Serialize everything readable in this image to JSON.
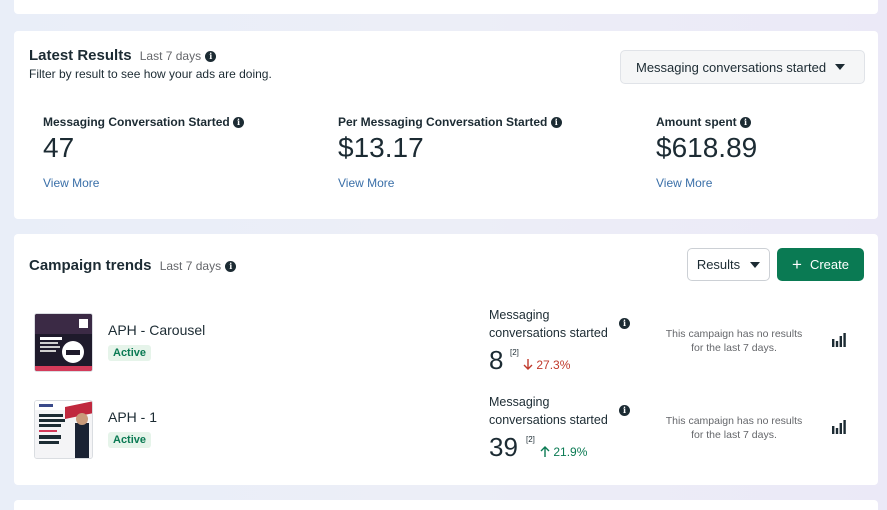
{
  "latest_results": {
    "title": "Latest Results",
    "period": "Last 7 days",
    "helper": "Filter by result to see how your ads are doing.",
    "filter_selected": "Messaging conversations started",
    "metrics": [
      {
        "label": "Messaging Conversation Started",
        "value": "47",
        "link": "View More"
      },
      {
        "label": "Per Messaging Conversation Started",
        "value": "$13.17",
        "link": "View More"
      },
      {
        "label": "Amount spent",
        "value": "$618.89",
        "link": "View More"
      }
    ]
  },
  "campaign_trends": {
    "title": "Campaign trends",
    "period": "Last 7 days",
    "results_button": "Results",
    "create_button": "Create",
    "campaigns": [
      {
        "name": "APH - Carousel",
        "status": "Active",
        "result_label": "Messaging conversations started",
        "result_value": "8",
        "result_sup": "[2]",
        "change": "27.3%",
        "change_direction": "down",
        "no_results_text": "This campaign has no results for the last 7 days."
      },
      {
        "name": "APH - 1",
        "status": "Active",
        "result_label": "Messaging conversations started",
        "result_value": "39",
        "result_sup": "[2]",
        "change": "21.9%",
        "change_direction": "up",
        "no_results_text": "This campaign has no results for the last 7 days."
      }
    ]
  },
  "colors": {
    "accent_green": "#0a7a53",
    "link_blue": "#3a6fa8",
    "down_red": "#c0392b",
    "text": "#1c2b33"
  },
  "icons": {
    "info": "info-icon",
    "caret": "chevron-down-icon",
    "plus": "plus-icon",
    "bar_chart": "bar-chart-icon",
    "arrow_down": "arrow-down-icon",
    "arrow_up": "arrow-up-icon"
  }
}
